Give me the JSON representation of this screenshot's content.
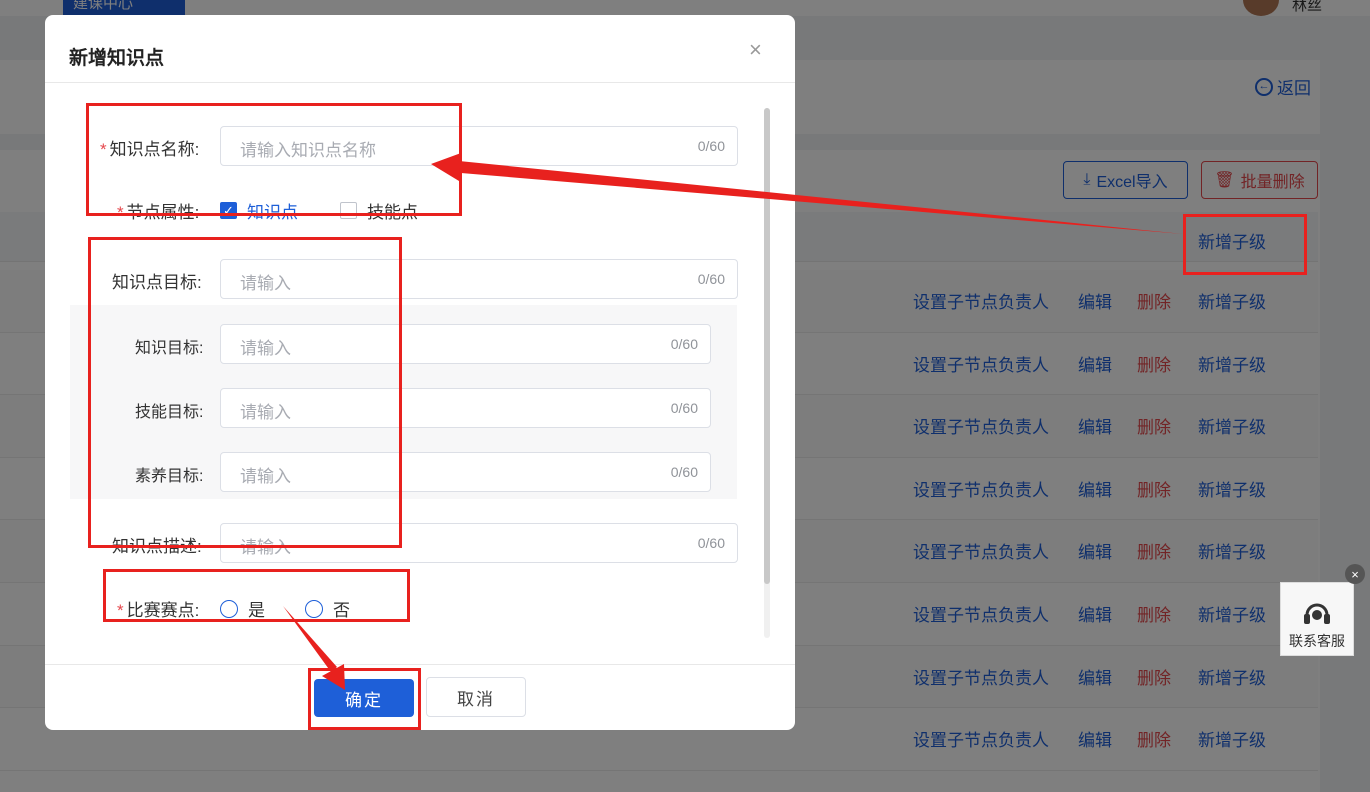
{
  "app": {
    "brand_tab": "建课中心",
    "user_name": "林丝",
    "back_label": "返回",
    "excel_import_label": "Excel导入",
    "batch_delete_label": "批量删除",
    "header_add_child": "新增子级"
  },
  "table": {
    "rows": [
      {
        "set_owner": "设置子节点负责人",
        "edit": "编辑",
        "delete": "删除",
        "add_child": "新增子级"
      },
      {
        "set_owner": "设置子节点负责人",
        "edit": "编辑",
        "delete": "删除",
        "add_child": "新增子级"
      },
      {
        "set_owner": "设置子节点负责人",
        "edit": "编辑",
        "delete": "删除",
        "add_child": "新增子级"
      },
      {
        "set_owner": "设置子节点负责人",
        "edit": "编辑",
        "delete": "删除",
        "add_child": "新增子级"
      },
      {
        "set_owner": "设置子节点负责人",
        "edit": "编辑",
        "delete": "删除",
        "add_child": "新增子级"
      },
      {
        "set_owner": "设置子节点负责人",
        "edit": "编辑",
        "delete": "删除",
        "add_child": "新增子级"
      },
      {
        "set_owner": "设置子节点负责人",
        "edit": "编辑",
        "delete": "删除",
        "add_child": "新增子级"
      },
      {
        "set_owner": "设置子节点负责人",
        "edit": "编辑",
        "delete": "删除",
        "add_child": "新增子级"
      }
    ]
  },
  "service": {
    "label": "联系客服",
    "close_symbol": "×"
  },
  "dialog": {
    "title": "新增知识点",
    "close_symbol": "×",
    "fields": {
      "name": {
        "label": "知识点名称:",
        "placeholder": "请输入知识点名称",
        "count": "0/60"
      },
      "attr": {
        "label": "节点属性:",
        "opt_knowledge": "知识点",
        "opt_skill": "技能点",
        "knowledge_checked": true,
        "skill_checked": false
      },
      "goal": {
        "label": "知识点目标:",
        "placeholder": "请输入",
        "count": "0/60"
      },
      "knowledge_goal": {
        "label": "知识目标:",
        "placeholder": "请输入",
        "count": "0/60"
      },
      "skill_goal": {
        "label": "技能目标:",
        "placeholder": "请输入",
        "count": "0/60"
      },
      "literacy_goal": {
        "label": "素养目标:",
        "placeholder": "请输入",
        "count": "0/60"
      },
      "desc": {
        "label": "知识点描述:",
        "placeholder": "请输入",
        "count": "0/60"
      },
      "contest": {
        "label": "比赛赛点:",
        "opt_yes": "是",
        "opt_no": "否"
      }
    },
    "confirm_label": "确定",
    "cancel_label": "取消"
  },
  "colors": {
    "primary": "#1e5fd8",
    "danger": "#e5484d",
    "annotation": "#e8211e"
  }
}
